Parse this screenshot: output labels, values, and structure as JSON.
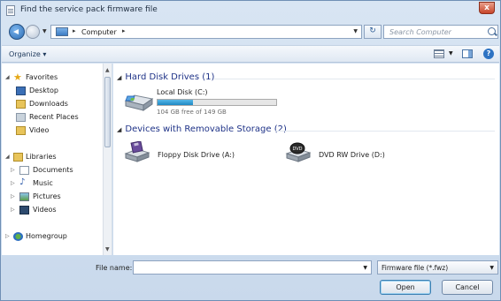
{
  "window": {
    "title": "Find the service pack firmware file"
  },
  "title_buttons": {
    "close": "x"
  },
  "address_bar": {
    "location": "Computer",
    "separator": "▸"
  },
  "search": {
    "placeholder": "Search Computer"
  },
  "toolbar": {
    "organize_label": "Organize ▾",
    "help_label": "?"
  },
  "nav": {
    "favorites": {
      "label": "Favorites",
      "items": [
        "Desktop",
        "Downloads",
        "Recent Places",
        "Video"
      ]
    },
    "libraries": {
      "label": "Libraries",
      "items": [
        "Documents",
        "Music",
        "Pictures",
        "Videos"
      ]
    },
    "homegroup": {
      "label": "Homegroup"
    }
  },
  "groups": [
    {
      "label": "Hard Disk Drives (1)"
    },
    {
      "label": "Devices with Removable Storage (2)"
    }
  ],
  "drives": {
    "local": {
      "name": "Local Disk (C:)",
      "free_text": "104 GB free of 149 GB",
      "used_fraction": 0.302
    },
    "floppy": {
      "name": "Floppy Disk Drive (A:)"
    },
    "dvd": {
      "name": "DVD RW Drive (D:)"
    }
  },
  "footer": {
    "file_name_label": "File name:",
    "file_name_value": "",
    "file_type": "Firmware file (*.fwz)",
    "open_label": "Open",
    "cancel_label": "Cancel"
  },
  "colors": {
    "accent": "#1e3287",
    "progress": "#1d88c4"
  }
}
